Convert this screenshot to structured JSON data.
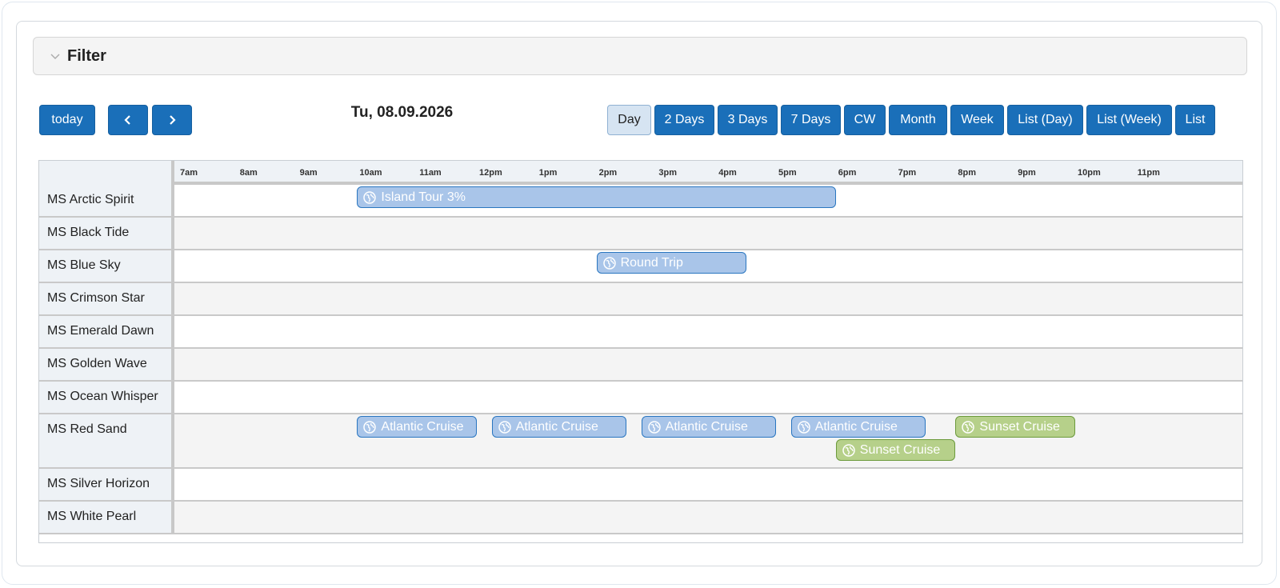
{
  "filter": {
    "label": "Filter"
  },
  "toolbar": {
    "today_label": "today",
    "date_title": "Tu, 08.09.2026",
    "views": [
      "Day",
      "2 Days",
      "3 Days",
      "7 Days",
      "CW",
      "Month",
      "Week",
      "List (Day)",
      "List (Week)",
      "List"
    ],
    "active_view": "Day"
  },
  "timeline": {
    "hours": [
      "7am",
      "8am",
      "9am",
      "10am",
      "11am",
      "12pm",
      "1pm",
      "2pm",
      "3pm",
      "4pm",
      "5pm",
      "6pm",
      "7pm",
      "8pm",
      "9pm",
      "10pm",
      "11pm"
    ]
  },
  "resources": [
    {
      "name": "MS Arctic Spirit"
    },
    {
      "name": "MS Black Tide"
    },
    {
      "name": "MS Blue Sky"
    },
    {
      "name": "MS Crimson Star"
    },
    {
      "name": "MS Emerald Dawn"
    },
    {
      "name": "MS Golden Wave"
    },
    {
      "name": "MS Ocean Whisper"
    },
    {
      "name": "MS Red Sand"
    },
    {
      "name": "MS Silver Horizon"
    },
    {
      "name": "MS White Pearl"
    }
  ],
  "events": [
    {
      "title": "Island Tour 3%",
      "resource": "MS Arctic Spirit",
      "start": "10:00",
      "end": "18:00",
      "color": "blue"
    },
    {
      "title": "Round Trip",
      "resource": "MS Blue Sky",
      "start": "14:00",
      "end": "16:30",
      "color": "blue"
    },
    {
      "title": "Atlantic Cruise",
      "resource": "MS Red Sand",
      "start": "10:00",
      "end": "12:00",
      "color": "blue"
    },
    {
      "title": "Atlantic Cruise",
      "resource": "MS Red Sand",
      "start": "12:15",
      "end": "14:30",
      "color": "blue"
    },
    {
      "title": "Atlantic Cruise",
      "resource": "MS Red Sand",
      "start": "14:45",
      "end": "17:00",
      "color": "blue"
    },
    {
      "title": "Atlantic Cruise",
      "resource": "MS Red Sand",
      "start": "17:15",
      "end": "19:30",
      "color": "blue"
    },
    {
      "title": "Sunset Cruise",
      "resource": "MS Red Sand",
      "start": "20:00",
      "end": "22:00",
      "color": "green"
    },
    {
      "title": "Sunset Cruise",
      "resource": "MS Red Sand",
      "start": "18:00",
      "end": "20:00",
      "color": "green"
    }
  ],
  "colors": {
    "primary_button": "#1a6fb9",
    "event_blue": "#a9c5e9",
    "event_green": "#b6d08a"
  },
  "icons": {
    "event_icon": "globe-icon",
    "prev": "chevron-left-icon",
    "next": "chevron-right-icon",
    "filter": "chevron-down-icon"
  }
}
